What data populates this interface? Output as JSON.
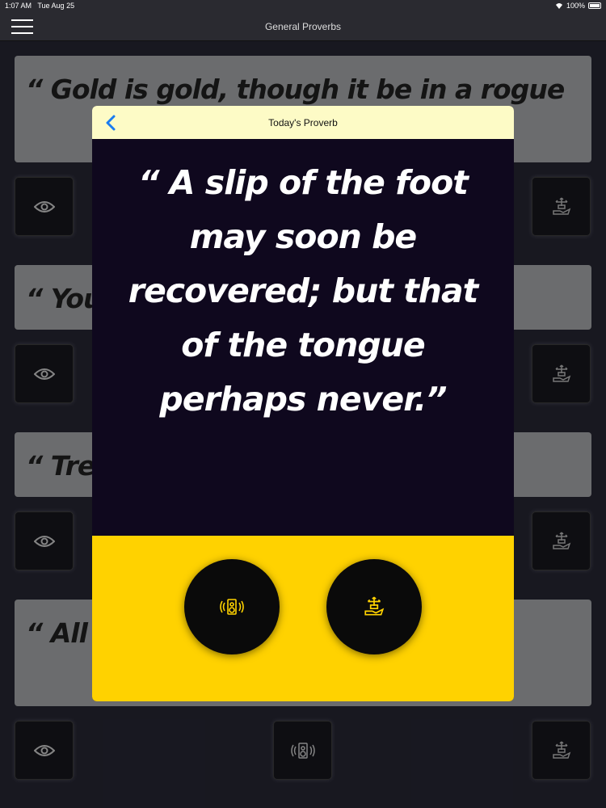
{
  "status_bar": {
    "time": "1:07 AM",
    "date": "Tue Aug 25",
    "battery": "100%"
  },
  "nav": {
    "title": "General Proverbs",
    "menu_icon": "hamburger-menu-icon"
  },
  "cards": [
    {
      "text": "“ Gold is gold, though it be in a rogue"
    },
    {
      "text": "“ You"
    },
    {
      "text": "“ Trea"
    },
    {
      "text": "“ All w called"
    }
  ],
  "icons": {
    "view": "eye-icon",
    "speaker": "speaker-icon",
    "share": "hand-share-icon",
    "back": "chevron-left-icon"
  },
  "modal": {
    "title": "Today's Proverb",
    "proverb": "“ A slip of the foot may soon be recovered; but that of the tongue perhaps never.”"
  },
  "colors": {
    "accent": "#ffd200",
    "header": "#fdfbc6",
    "modal_bg": "#0f081e",
    "card_bg": "#898b8d"
  }
}
